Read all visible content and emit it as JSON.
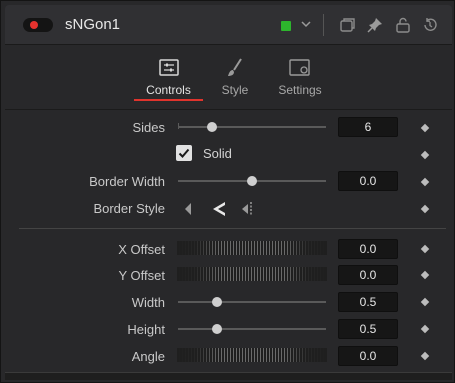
{
  "header": {
    "title": "sNGon1",
    "toggle_color": "#e5322e",
    "node_color": "#2db52d",
    "icons": [
      "color-chevron-icon",
      "copy-icon",
      "pin-icon",
      "lock-icon",
      "reset-icon"
    ]
  },
  "tabs": [
    {
      "label": "Controls",
      "icon": "controls-sliders-icon",
      "active": true
    },
    {
      "label": "Style",
      "icon": "brush-icon",
      "active": false
    },
    {
      "label": "Settings",
      "icon": "settings-panel-icon",
      "active": false
    }
  ],
  "controls": {
    "sides": {
      "label": "Sides",
      "value": "6",
      "fraction": 0.22
    },
    "solid": {
      "label": "Solid",
      "checked": true
    },
    "border_width": {
      "label": "Border Width",
      "value": "0.0",
      "fraction": 0.5
    },
    "border_style": {
      "label": "Border Style",
      "options": [
        "border-inside-icon",
        "border-center-icon",
        "border-outside-icon"
      ]
    },
    "x_offset": {
      "label": "X Offset",
      "value": "0.0"
    },
    "y_offset": {
      "label": "Y Offset",
      "value": "0.0"
    },
    "width": {
      "label": "Width",
      "value": "0.5",
      "fraction": 0.25
    },
    "height": {
      "label": "Height",
      "value": "0.5",
      "fraction": 0.25
    },
    "angle": {
      "label": "Angle",
      "value": "0.0"
    }
  }
}
